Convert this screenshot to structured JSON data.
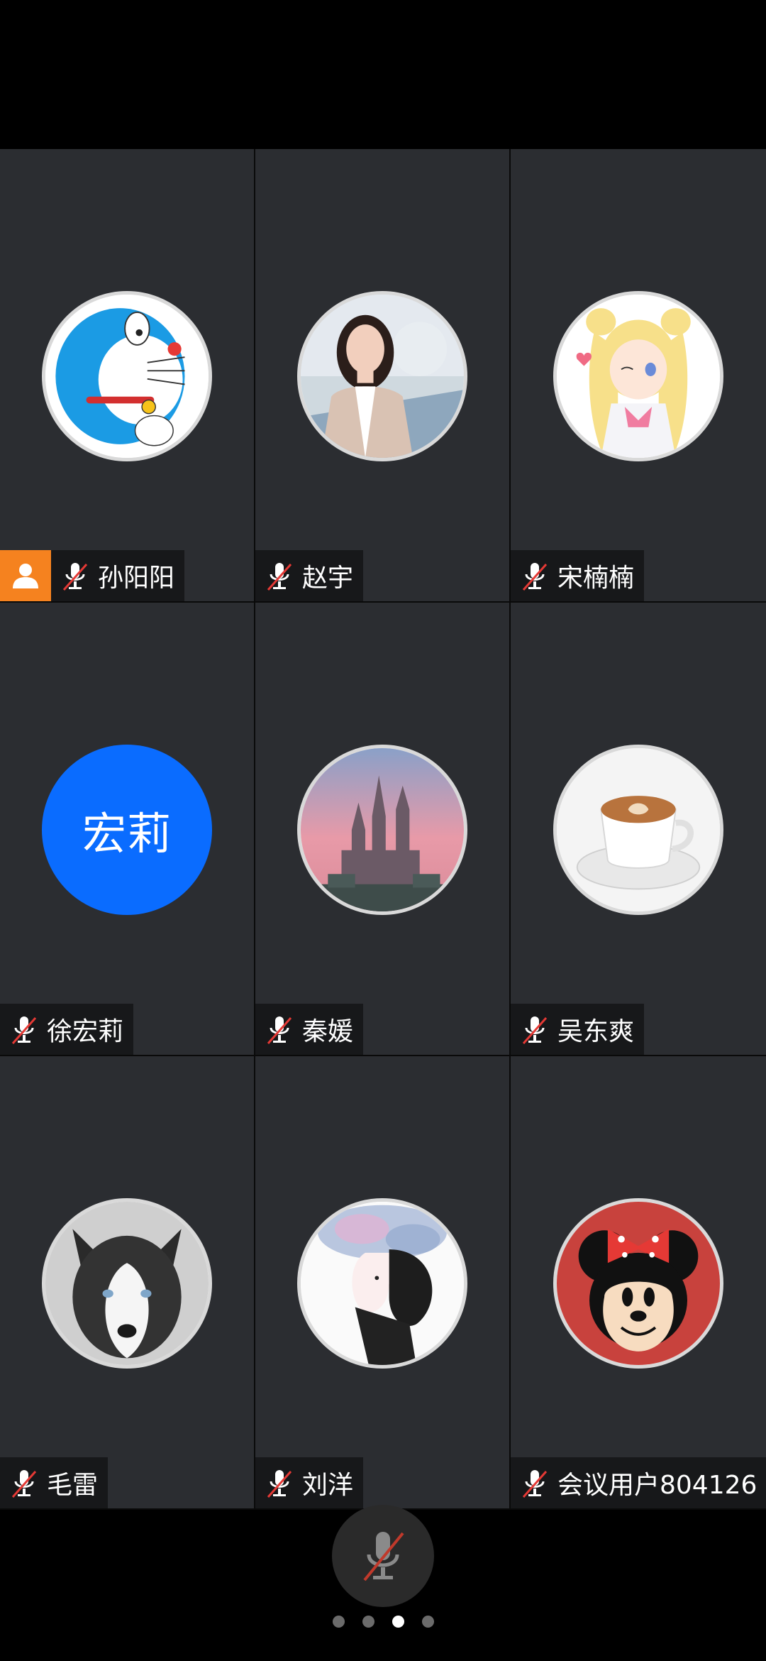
{
  "participants": [
    {
      "name": "孙阳阳",
      "avatar": "doraemon-avatar",
      "host": true,
      "muted": true
    },
    {
      "name": "赵宇",
      "avatar": "woman-photo-avatar",
      "host": false,
      "muted": true
    },
    {
      "name": "宋楠楠",
      "avatar": "anime-girl-avatar",
      "host": false,
      "muted": true
    },
    {
      "name": "徐宏莉",
      "avatar_text": "宏莉",
      "avatar_color": "#0a6cff",
      "host": false,
      "muted": true
    },
    {
      "name": "秦媛",
      "avatar": "castle-avatar",
      "host": false,
      "muted": true
    },
    {
      "name": "吴东爽",
      "avatar": "coffee-cup-avatar",
      "host": false,
      "muted": true
    },
    {
      "name": "毛雷",
      "avatar": "husky-dog-avatar",
      "host": false,
      "muted": true
    },
    {
      "name": "刘洋",
      "avatar": "illustrated-woman-avatar",
      "host": false,
      "muted": true
    },
    {
      "name": "会议用户804126",
      "avatar": "minnie-mouse-avatar",
      "host": false,
      "muted": true
    }
  ],
  "controls": {
    "mic_button_icon": "microphone-muted-icon",
    "host_badge_color": "#f5821f"
  },
  "pagination": {
    "total_pages": 4,
    "current_page": 3
  }
}
